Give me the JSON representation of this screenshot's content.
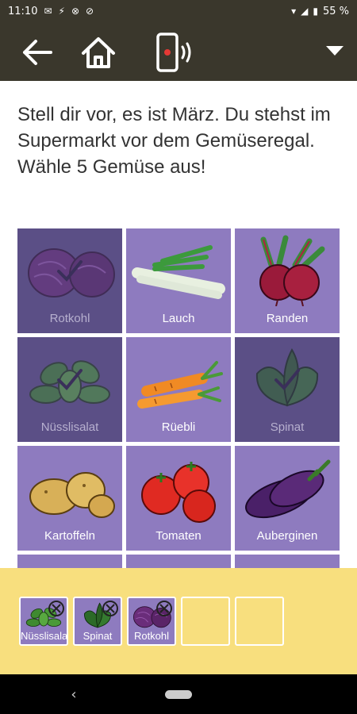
{
  "status_bar": {
    "time": "11:10",
    "battery": "55 %",
    "icons": [
      "messages-icon",
      "bolt-icon",
      "blocked-icon",
      "no-entry-icon",
      "wifi-icon",
      "signal-icon",
      "battery-icon"
    ]
  },
  "app_bar": {
    "back_icon": "arrow-left-icon",
    "home_icon": "home-icon",
    "device_icon": "phone-vibrate-icon",
    "palette_colors": [
      "#c86a6a",
      "#a8c86a",
      "#a0d8d8",
      "#e0a0c8",
      "#8898d8",
      "#d8e878",
      "#58b878",
      "#c8a8e8",
      "#e8b8a0"
    ],
    "dropdown_icon": "triangle-down-icon"
  },
  "prompt": "Stell dir vor, es ist März. Du stehst im Supermarkt vor dem Gemüseregal. Wähle 5 Gemüse aus!",
  "colors": {
    "tile": "#8e7bbf",
    "tile_selected": "#5b4f86",
    "tray": "#f8df7e",
    "app_bar": "#3a372c"
  },
  "vegetables": [
    {
      "label": "Rotkohl",
      "selected": true,
      "icon": "red-cabbage-icon"
    },
    {
      "label": "Lauch",
      "selected": false,
      "icon": "leek-icon"
    },
    {
      "label": "Randen",
      "selected": false,
      "icon": "beetroot-icon"
    },
    {
      "label": "Nüsslisalat",
      "selected": true,
      "icon": "lambs-lettuce-icon"
    },
    {
      "label": "Rüebli",
      "selected": false,
      "icon": "carrot-icon"
    },
    {
      "label": "Spinat",
      "selected": true,
      "icon": "spinach-icon"
    },
    {
      "label": "Kartoffeln",
      "selected": false,
      "icon": "potato-icon"
    },
    {
      "label": "Tomaten",
      "selected": false,
      "icon": "tomato-icon"
    },
    {
      "label": "Auberginen",
      "selected": false,
      "icon": "eggplant-icon"
    }
  ],
  "tray": {
    "slots": [
      {
        "label": "Nüsslisalat",
        "filled": true
      },
      {
        "label": "Spinat",
        "filled": true
      },
      {
        "label": "Rotkohl",
        "filled": true
      },
      {
        "label": "",
        "filled": false
      },
      {
        "label": "",
        "filled": false
      }
    ]
  }
}
